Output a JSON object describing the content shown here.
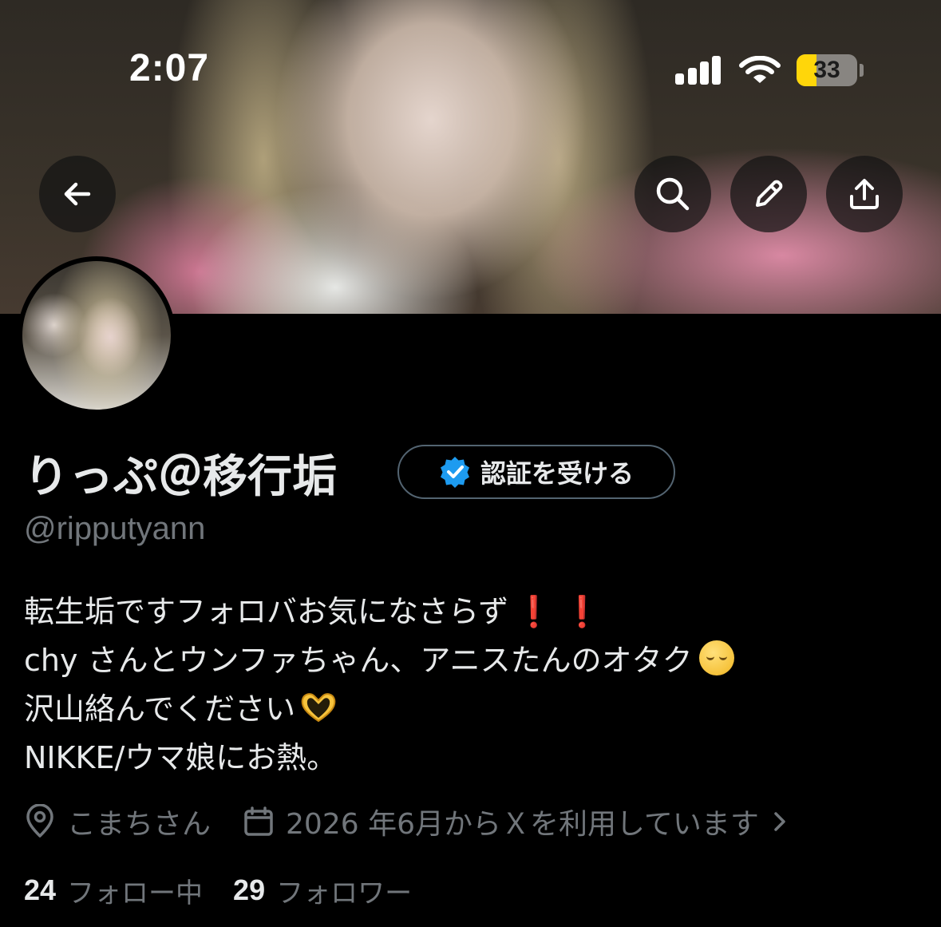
{
  "status_bar": {
    "time": "2:07",
    "battery_percent": "33",
    "battery_level": 0.33,
    "icons": [
      "cellular-signal-icon",
      "wifi-icon",
      "battery-icon"
    ]
  },
  "header": {
    "buttons": [
      "back-arrow-icon",
      "search-icon",
      "edit-pencil-icon",
      "share-icon"
    ]
  },
  "profile": {
    "display_name": "りっぷ＠移行垢",
    "verify_button_label": "認証を受ける",
    "handle": "@ripputyann",
    "bio_lines": [
      "転生垢ですフォロバお気になさらず",
      "chy さんとウンファちゃん、アニスたんのオタク",
      "沢山絡んでください",
      "NIKKE/ウマ娘にお熱。"
    ],
    "bio_emoji": {
      "line1": "❗ ❗",
      "line2": "pensive-face-emoji",
      "line3": "heart-hands-emoji"
    },
    "location": "こまちさん",
    "joined": "2026 年6月からＸを利用しています",
    "following_count": "24",
    "following_label": "フォロー中",
    "followers_count": "29",
    "followers_label": "フォロワー"
  },
  "colors": {
    "background": "#000000",
    "text_primary": "#e7e9ea",
    "text_secondary": "#71767b",
    "border": "#536471",
    "verified_blue": "#1d9bf0",
    "battery_yellow": "#ffd60a",
    "alert_red": "#e0242e"
  }
}
